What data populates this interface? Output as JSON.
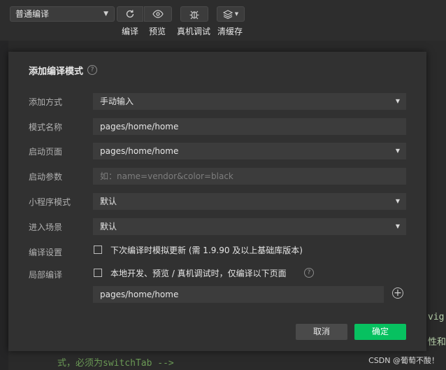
{
  "toolbar": {
    "mode_select": "普通编译",
    "buttons": [
      {
        "label": "编译",
        "icon": "refresh-icon"
      },
      {
        "label": "预览",
        "icon": "eye-icon"
      },
      {
        "label": "真机调试",
        "icon": "bug-icon"
      },
      {
        "label": "清缓存",
        "icon": "layers-icon"
      }
    ]
  },
  "background": {
    "line_bottom": "式，必须为switchTab -->",
    "right_fragment_1": "vig",
    "right_fragment_2": "性和",
    "watermark": "CSDN @葡萄不酸！"
  },
  "dialog": {
    "title": "添加编译模式",
    "rows": {
      "add_method": {
        "label": "添加方式",
        "value": "手动输入"
      },
      "mode_name": {
        "label": "模式名称",
        "value": "pages/home/home"
      },
      "start_page": {
        "label": "启动页面",
        "value": "pages/home/home"
      },
      "start_params": {
        "label": "启动参数",
        "placeholder": "如：name=vendor&color=black"
      },
      "mp_mode": {
        "label": "小程序模式",
        "value": "默认"
      },
      "scene": {
        "label": "进入场景",
        "value": "默认"
      },
      "compile_settings": {
        "label": "编译设置",
        "checkbox_text": "下次编译时模拟更新 (需 1.9.90 及以上基础库版本)",
        "checked": false
      },
      "partial_compile": {
        "label": "局部编译",
        "checkbox_text": "本地开发、预览 / 真机调试时，仅编译以下页面",
        "checked": false,
        "page": "pages/home/home"
      }
    },
    "cancel": "取消",
    "confirm": "确定"
  },
  "colors": {
    "accent": "#07c160",
    "background": "#313131"
  }
}
